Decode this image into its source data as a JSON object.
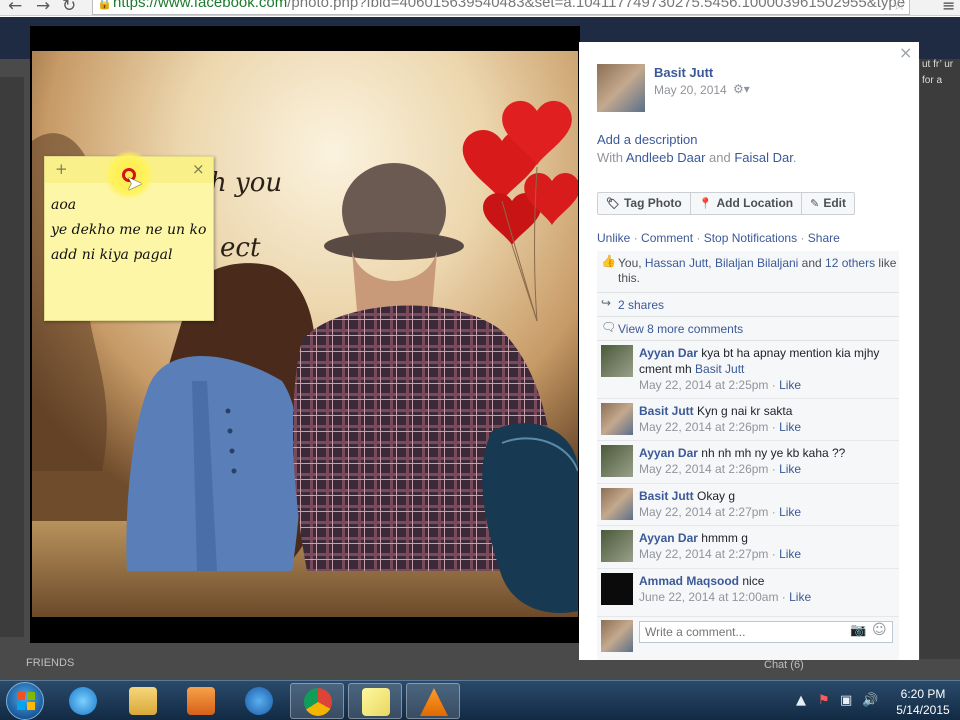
{
  "browser": {
    "url_prefix": "https://",
    "url_host": "www.facebook.com",
    "url_rest": "/photo.php?fbid=406015639540483&set=a.104117749730275.5456.100003961502955&type"
  },
  "sticky_note": {
    "add_icon": "plus-icon",
    "close_icon": "close-icon",
    "lines": [
      "aoa",
      "ye dekho me ne un ko",
      "add ni kiya pagal"
    ]
  },
  "photo": {
    "overlay_text_1": "h you",
    "overlay_text_2": "ect"
  },
  "panel": {
    "owner_name": "Basit Jutt",
    "date": "May 20, 2014",
    "privacy_icon": "gear-dropdown-icon",
    "add_description": "Add a description",
    "with_prefix": "With ",
    "with_person_1": "Andleeb Daar",
    "with_and": " and ",
    "with_person_2": "Faisal Dar",
    "with_suffix": ".",
    "actions": {
      "tag_photo": "Tag Photo",
      "add_location": "Add Location",
      "edit": "Edit"
    },
    "ufi_links": {
      "unlike": "Unlike",
      "comment": "Comment",
      "stop_notifications": "Stop Notifications",
      "share": "Share",
      "separator": " · "
    },
    "likes": {
      "you": "You, ",
      "names": "Hassan Jutt, Bilaljan Bilaljani",
      "and": " and ",
      "others": "12 others",
      "suffix": " like this."
    },
    "shares": "2 shares",
    "view_more": "View 8 more comments",
    "comments": [
      {
        "author": "Ayyan Dar",
        "text": "kya bt ha apnay mention kia mjhy cment mh ",
        "mention": "Basit Jutt",
        "time": "May 22, 2014 at 2:25pm",
        "like": "Like"
      },
      {
        "author": "Basit Jutt",
        "text": "Kyn g nai kr sakta",
        "mention": "",
        "time": "May 22, 2014 at 2:26pm",
        "like": "Like"
      },
      {
        "author": "Ayyan Dar",
        "text": "nh nh mh ny ye kb kaha ??",
        "mention": "",
        "time": "May 22, 2014 at 2:26pm",
        "like": "Like"
      },
      {
        "author": "Basit Jutt",
        "text": "Okay g",
        "mention": "",
        "time": "May 22, 2014 at 2:27pm",
        "like": "Like"
      },
      {
        "author": "Ayyan Dar",
        "text": "hmmm g",
        "mention": "",
        "time": "May 22, 2014 at 2:27pm",
        "like": "Like"
      },
      {
        "author": "Ammad Maqsood",
        "text": "nice",
        "mention": "",
        "time": "June 22, 2014 at 12:00am",
        "like": "Like"
      }
    ],
    "comment_placeholder": "Write a comment...",
    "meta_separator": " · "
  },
  "background": {
    "right_text": "ut fr’ ur\nfor a",
    "friends_label": "FRIENDS",
    "chat_label": "Chat (6)"
  },
  "taskbar": {
    "time": "6:20 PM",
    "date": "5/14/2015"
  }
}
